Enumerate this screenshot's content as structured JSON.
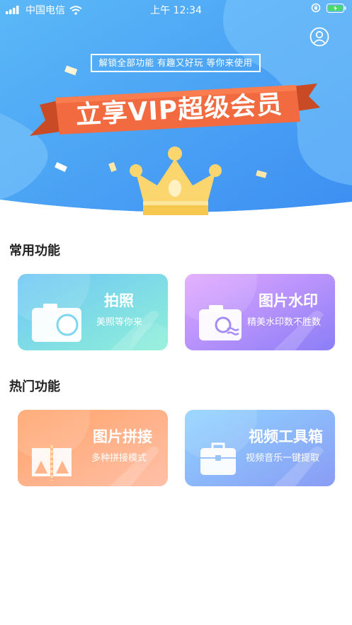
{
  "status_bar": {
    "carrier": "中国电信",
    "time": "上午 12:34"
  },
  "hero": {
    "tagline": "解锁全部功能 有趣又好玩 等你来使用",
    "banner_text": "立享VIP超级会员",
    "profile_icon": "user-circle-icon",
    "crown_icon": "crown-icon"
  },
  "common_section": {
    "title": "常用功能",
    "cards": [
      {
        "title": "拍照",
        "subtitle": "美照等你来",
        "icon": "camera-icon",
        "gradient": [
          "#6ec6f5",
          "#8ff0d8"
        ]
      },
      {
        "title": "图片水印",
        "subtitle": "精美水印数不胜数",
        "icon": "watermark-camera-icon",
        "gradient": [
          "#e1a6ff",
          "#8b7ef7"
        ]
      }
    ]
  },
  "hot_section": {
    "title": "热门功能",
    "cards": [
      {
        "title": "图片拼接",
        "subtitle": "多种拼接模式",
        "icon": "photo-stitch-icon",
        "gradient": [
          "#ffa36a",
          "#ffc0a8"
        ]
      },
      {
        "title": "视频工具箱",
        "subtitle": "视频音乐一键提取",
        "icon": "toolbox-icon",
        "gradient": [
          "#8fd4ff",
          "#8a9cf5"
        ]
      }
    ]
  },
  "colors": {
    "hero_blue": "#4aa3f5",
    "banner_orange": "#f26a3f",
    "crown_gold": "#fbd56e"
  }
}
